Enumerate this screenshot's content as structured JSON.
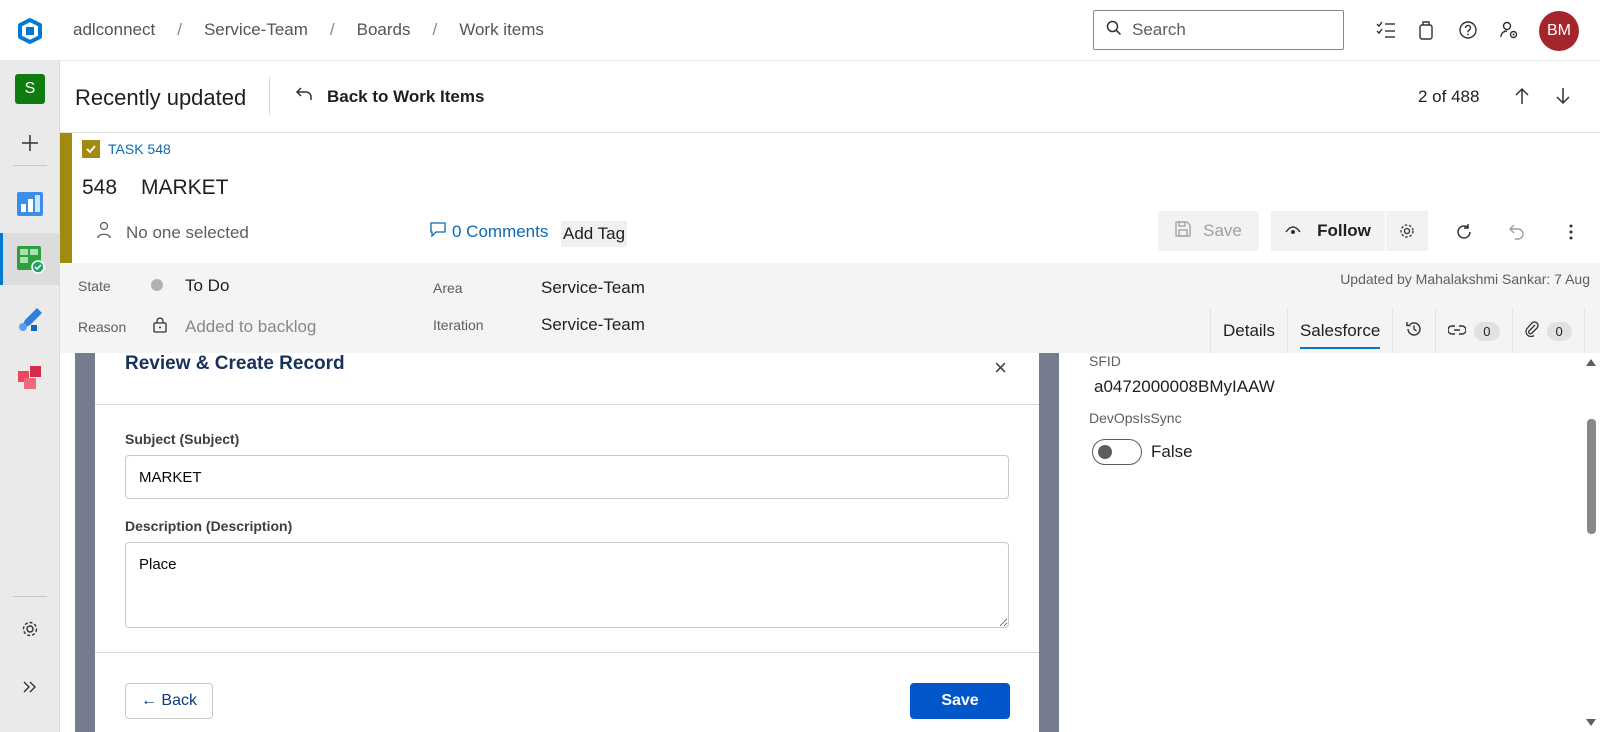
{
  "topbar": {
    "breadcrumb": [
      "adlconnect",
      "Service-Team",
      "Boards",
      "Work items"
    ],
    "search_placeholder": "Search",
    "avatar_initials": "BM",
    "icons": [
      "task-list-icon",
      "shopping-bag-icon",
      "help-icon",
      "user-settings-icon"
    ]
  },
  "rail": {
    "project_initial": "S",
    "items": [
      "add-icon",
      "overview-icon",
      "boards-icon",
      "pipelines-icon",
      "artifacts-icon",
      "settings-icon",
      "expand-icon"
    ]
  },
  "header": {
    "title": "Recently updated",
    "back_label": "Back to Work Items",
    "pager": "2 of 488"
  },
  "work_item": {
    "type_label": "TASK 548",
    "id": "548",
    "title": "MARKET",
    "assignee": "No one selected",
    "comments": "0 Comments",
    "add_tag": "Add Tag",
    "save_label": "Save",
    "follow_label": "Follow"
  },
  "fields": {
    "state_label": "State",
    "state_value": "To Do",
    "reason_label": "Reason",
    "reason_value": "Added to backlog",
    "area_label": "Area",
    "area_value": "Service-Team",
    "iteration_label": "Iteration",
    "iteration_value": "Service-Team",
    "updated_by": "Updated by Mahalakshmi Sankar: 7 Aug"
  },
  "tabs": {
    "details": "Details",
    "salesforce": "Salesforce",
    "links_count": "0",
    "attachments_count": "0"
  },
  "modal": {
    "title": "Review & Create Record",
    "close": "×",
    "subject_label": "Subject (Subject)",
    "subject_value": "MARKET",
    "description_label": "Description (Description)",
    "description_value": "Place",
    "back_label": "← Back",
    "save_label": "Save"
  },
  "salesforce": {
    "sfid_label": "SFID",
    "sfid_value": "a0472000008BMyIAAW",
    "sync_label": "DevOpsIsSync",
    "sync_value": "False"
  },
  "colors": {
    "accent": "#0078d4",
    "task_color": "#a08a0f",
    "avatar": "#a4262c",
    "sf_button": "#0157c9",
    "modal_backdrop": "#747c8d"
  }
}
